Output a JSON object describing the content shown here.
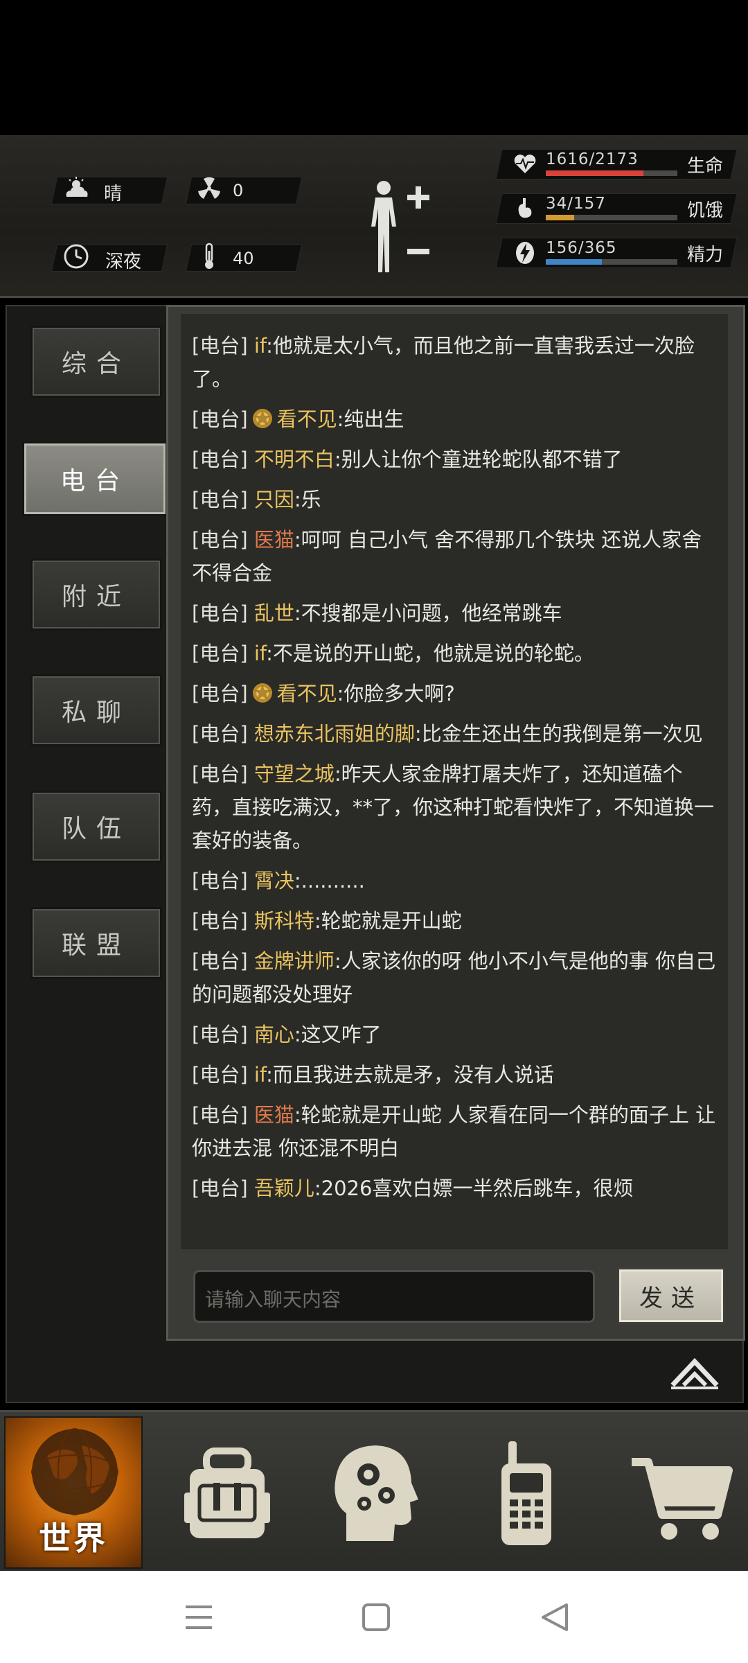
{
  "status": {
    "weather": {
      "icon": "cloudy-sun-icon",
      "label": "晴"
    },
    "radiation": {
      "icon": "radiation-icon",
      "value": "0"
    },
    "time_of_day": {
      "icon": "clock-icon",
      "label": "深夜"
    },
    "temperature": {
      "icon": "thermometer-icon",
      "value": "40"
    },
    "vitals": [
      {
        "key": "health",
        "icon": "heart-pulse-icon",
        "value": "1616/2173",
        "label": "生命",
        "fraction": 0.744,
        "color": "#d9433a"
      },
      {
        "key": "hunger",
        "icon": "stomach-icon",
        "value": "34/157",
        "label": "饥饿",
        "fraction": 0.217,
        "color": "#d39a2f"
      },
      {
        "key": "energy",
        "icon": "energy-bolt-icon",
        "value": "156/365",
        "label": "精力",
        "fraction": 0.427,
        "color": "#3f86c9"
      }
    ]
  },
  "side_tabs": [
    {
      "label": "综合",
      "active": false
    },
    {
      "label": "电台",
      "active": true
    },
    {
      "label": "附近",
      "active": false
    },
    {
      "label": "私聊",
      "active": false
    },
    {
      "label": "队伍",
      "active": false
    },
    {
      "label": "联盟",
      "active": false
    }
  ],
  "chat": {
    "tag": "[电台]",
    "messages": [
      {
        "user": "if",
        "user_color": "gold",
        "badge": false,
        "text": ":他就是太小气，而且他之前一直害我丢过一次脸了。"
      },
      {
        "user": "看不见",
        "user_color": "gold",
        "badge": true,
        "text": ":纯出生"
      },
      {
        "user": "不明不白",
        "user_color": "gold",
        "badge": false,
        "text": ":别人让你个童进轮蛇队都不错了"
      },
      {
        "user": "只因",
        "user_color": "gold",
        "badge": false,
        "text": ":乐"
      },
      {
        "user": "医猫",
        "user_color": "red",
        "badge": false,
        "text": ":呵呵 自己小气 舍不得那几个铁块 还说人家舍不得合金"
      },
      {
        "user": "乱世",
        "user_color": "gold",
        "badge": false,
        "text": ":不搜都是小问题，他经常跳车"
      },
      {
        "user": "if",
        "user_color": "gold",
        "badge": false,
        "text": ":不是说的开山蛇，他就是说的轮蛇。"
      },
      {
        "user": "看不见",
        "user_color": "gold",
        "badge": true,
        "text": ":你脸多大啊?"
      },
      {
        "user": "想赤东北雨姐的脚",
        "user_color": "gold",
        "badge": false,
        "text": ":比金生还出生的我倒是第一次见"
      },
      {
        "user": "守望之城",
        "user_color": "gold",
        "badge": false,
        "text": ":昨天人家金牌打屠夫炸了，还知道磕个药，直接吃满汉，**了，你这种打蛇看快炸了，不知道换一套好的装备。"
      },
      {
        "user": "霄决",
        "user_color": "gold",
        "badge": false,
        "text": ":.........."
      },
      {
        "user": "斯科特",
        "user_color": "gold",
        "badge": false,
        "text": ":轮蛇就是开山蛇"
      },
      {
        "user": "金牌讲师",
        "user_color": "gold",
        "badge": false,
        "text": ":人家该你的呀 他小不小气是他的事 你自己的问题都没处理好"
      },
      {
        "user": "南心",
        "user_color": "gold",
        "badge": false,
        "text": ":这又咋了"
      },
      {
        "user": "if",
        "user_color": "gold",
        "badge": false,
        "text": ":而且我进去就是矛，没有人说话"
      },
      {
        "user": "医猫",
        "user_color": "red",
        "badge": false,
        "text": ":轮蛇就是开山蛇 人家看在同一个群的面子上 让你进去混 你还混不明白"
      },
      {
        "user": "吾颖儿",
        "user_color": "gold",
        "badge": false,
        "text": ":2026喜欢白嫖一半然后跳车，很烦"
      }
    ],
    "input_placeholder": "请输入聊天内容",
    "send_label": "发送"
  },
  "bottom_nav": {
    "world_label": "世界",
    "items": [
      {
        "icon": "backpack-icon"
      },
      {
        "icon": "brain-skills-icon"
      },
      {
        "icon": "walkie-talkie-icon"
      },
      {
        "icon": "shopping-cart-icon"
      }
    ]
  },
  "system_nav": [
    {
      "icon": "menu-icon"
    },
    {
      "icon": "home-square-icon"
    },
    {
      "icon": "back-triangle-icon"
    }
  ]
}
